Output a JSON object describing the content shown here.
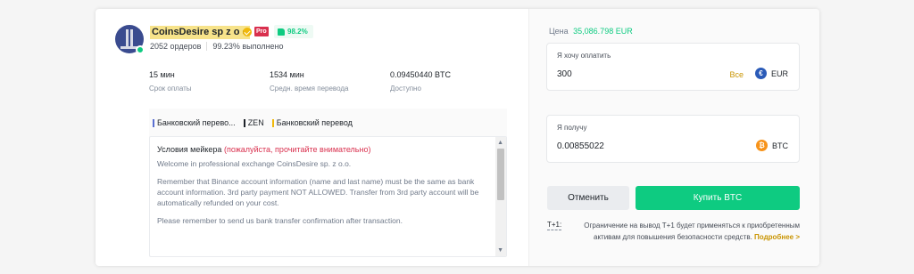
{
  "merchant": {
    "name": "CoinsDesire sp z o o",
    "pro_badge": "Pro",
    "rating": "98.2%",
    "orders": "2052 ордеров",
    "completion": "99.23% выполнено"
  },
  "stats": [
    {
      "value": "15 мин",
      "label": "Срок оплаты"
    },
    {
      "value": "1534 мин",
      "label": "Средн. время перевода"
    },
    {
      "value": "0.09450440 BTC",
      "label": "Доступно"
    }
  ],
  "payment_methods": [
    {
      "label": "Банковский перево...",
      "color": "#5a6fd1"
    },
    {
      "label": "ZEN",
      "color": "#1e2329"
    },
    {
      "label": "Банковский перевод",
      "color": "#f0b90b"
    }
  ],
  "terms": {
    "title": "Условия мейкера",
    "warning": "(пожалуйста, прочитайте внимательно)",
    "paragraphs": [
      "Welcome in professional exchange CoinsDesire sp. z o.o.",
      "Remember that Binance account information (name and last name) must be the same as bank account information. 3rd party payment NOT ALLOWED. Transfer from 3rd party account will be automatically refunded on your cost.",
      "Please remember to send us bank transfer confirmation after transaction."
    ]
  },
  "order": {
    "price_label": "Цена",
    "price_value": "35,086.798 EUR",
    "pay": {
      "label": "Я хочу оплатить",
      "value": "300",
      "all_label": "Все",
      "currency": "EUR",
      "coin_color": "#2b5bb8"
    },
    "receive": {
      "label": "Я получу",
      "value": "0.00855022",
      "currency": "BTC",
      "coin_color": "#f7931a"
    },
    "cancel_label": "Отменить",
    "buy_label": "Купить BTC",
    "t1_label": "T+1:",
    "notice": "Ограничение на вывод T+1 будет применяться к приобретенным активам для повышения безопасности средств.",
    "more_label": "Подробнее >"
  }
}
